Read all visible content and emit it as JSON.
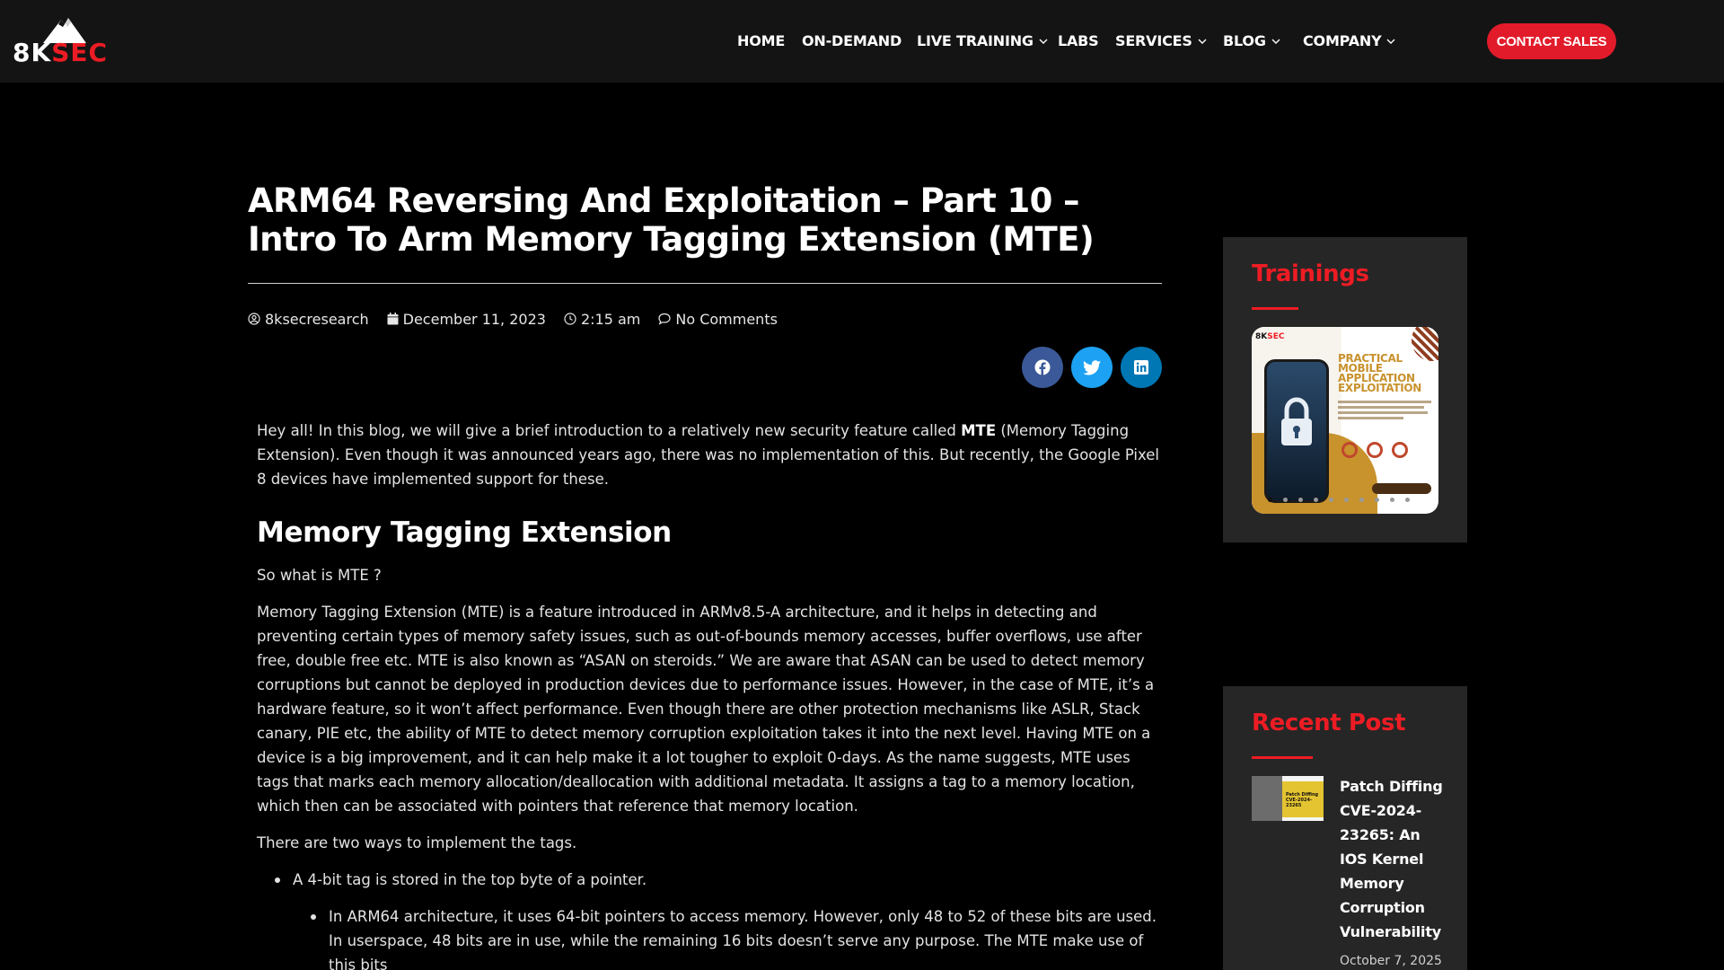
{
  "header": {
    "logo": {
      "part1": "8K",
      "part2": "SEC"
    },
    "nav": [
      {
        "label": "HOME",
        "dropdown": false
      },
      {
        "label": "ON-DEMAND",
        "dropdown": false
      },
      {
        "label": "LIVE TRAINING",
        "dropdown": true
      },
      {
        "label": "LABS",
        "dropdown": false
      },
      {
        "label": "SERVICES",
        "dropdown": true
      },
      {
        "label": "BLOG",
        "dropdown": true
      },
      {
        "label": "COMPANY",
        "dropdown": true
      }
    ],
    "contact_label": "CONTACT SALES"
  },
  "article": {
    "title": "ARM64 Reversing And Exploitation – Part 10 – Intro To Arm Memory Tagging Extension (MTE)",
    "meta": {
      "author": "8ksecresearch",
      "date": "December 11, 2023",
      "time": "2:15 am",
      "comments": "No Comments"
    },
    "intro": {
      "before": "Hey all! In this blog, we will give a brief introduction to a relatively new security feature called ",
      "bold": "MTE",
      "after": " (Memory Tagging Extension). Even though it was announced years ago, there was no implementation of this. But recently, the Google Pixel 8 devices have implemented support for these."
    },
    "heading": "Memory Tagging Extension",
    "question": "So what is MTE ?",
    "paragraph": "Memory Tagging Extension (MTE) is a feature introduced in ARMv8.5-A architecture, and it helps in detecting and preventing certain types of memory safety issues, such as out-of-bounds memory accesses, buffer overflows, use after free, double free etc. MTE is also known as “ASAN on steroids.” We are aware that ASAN can be used to detect memory corruptions but cannot be deployed in production devices due to performance issues. However, in the case of MTE, it’s a hardware feature, so it won’t affect performance. Even though there are other protection mechanisms like ASLR, Stack canary, PIE etc, the ability of MTE to detect memory corruption exploitation takes it into the next level. Having MTE on a device is a big improvement, and it can help make it a lot tougher to exploit 0-days. As the name suggests, MTE uses tags that marks each memory allocation/deallocation with additional metadata. It assigns a tag to a memory location, which then can be associated with pointers that reference that memory location.",
    "ways_intro": "There are two ways to implement the tags.",
    "bullet1": "A 4-bit tag is stored in the top byte of a pointer.",
    "sub_bullet1": "In ARM64 architecture, it uses 64-bit pointers to access memory. However, only 48 to 52 of these bits are used. In userspace, 48 bits are in use, while the remaining 16 bits doesn’t serve any purpose. The MTE make use of this bits"
  },
  "sidebar": {
    "trainings_title": "Trainings",
    "training_card": {
      "logo_a": "8K",
      "logo_b": "SEC",
      "title": "PRACTICAL MOBILE APPLICATION EXPLOITATION"
    },
    "recent_title": "Recent Post",
    "recent_post": {
      "title": "Patch Diffing CVE-2024-23265: An IOS Kernel Memory Corruption Vulnerability",
      "date": "October 7, 2025",
      "thumb_text": "Patch Diffing CVE-2024-23265"
    }
  },
  "colors": {
    "brand_red": "#ed1c24",
    "facebook": "#3b5998",
    "twitter": "#1da1f2",
    "linkedin": "#0077b5"
  },
  "icons": [
    "user-icon",
    "calendar-icon",
    "clock-icon",
    "comment-icon",
    "facebook-icon",
    "twitter-icon",
    "linkedin-icon",
    "chevron-down-icon"
  ]
}
